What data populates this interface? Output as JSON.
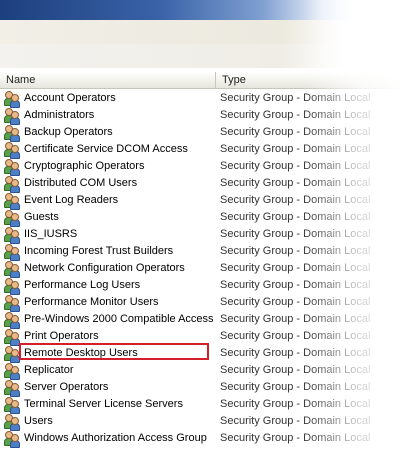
{
  "columns": {
    "name": "Name",
    "type": "Type"
  },
  "rows": [
    {
      "name": "Account Operators",
      "type": "Security Group - Domain Local"
    },
    {
      "name": "Administrators",
      "type": "Security Group - Domain Local"
    },
    {
      "name": "Backup Operators",
      "type": "Security Group - Domain Local"
    },
    {
      "name": "Certificate Service DCOM Access",
      "type": "Security Group - Domain Local"
    },
    {
      "name": "Cryptographic Operators",
      "type": "Security Group - Domain Local"
    },
    {
      "name": "Distributed COM Users",
      "type": "Security Group - Domain Local"
    },
    {
      "name": "Event Log Readers",
      "type": "Security Group - Domain Local"
    },
    {
      "name": "Guests",
      "type": "Security Group - Domain Local"
    },
    {
      "name": "IIS_IUSRS",
      "type": "Security Group - Domain Local"
    },
    {
      "name": "Incoming Forest Trust Builders",
      "type": "Security Group - Domain Local"
    },
    {
      "name": "Network Configuration Operators",
      "type": "Security Group - Domain Local"
    },
    {
      "name": "Performance Log Users",
      "type": "Security Group - Domain Local"
    },
    {
      "name": "Performance Monitor Users",
      "type": "Security Group - Domain Local"
    },
    {
      "name": "Pre-Windows 2000 Compatible Access",
      "type": "Security Group - Domain Local"
    },
    {
      "name": "Print Operators",
      "type": "Security Group - Domain Local"
    },
    {
      "name": "Remote Desktop Users",
      "type": "Security Group - Domain Local"
    },
    {
      "name": "Replicator",
      "type": "Security Group - Domain Local"
    },
    {
      "name": "Server Operators",
      "type": "Security Group - Domain Local"
    },
    {
      "name": "Terminal Server License Servers",
      "type": "Security Group - Domain Local"
    },
    {
      "name": "Users",
      "type": "Security Group - Domain Local"
    },
    {
      "name": "Windows Authorization Access Group",
      "type": "Security Group - Domain Local"
    }
  ],
  "highlighted_row": "Remote Desktop Users",
  "colors": {
    "highlight_border": "#d21f2a",
    "title_bar": "#1d3f7e"
  },
  "icon": "security-group-icon"
}
